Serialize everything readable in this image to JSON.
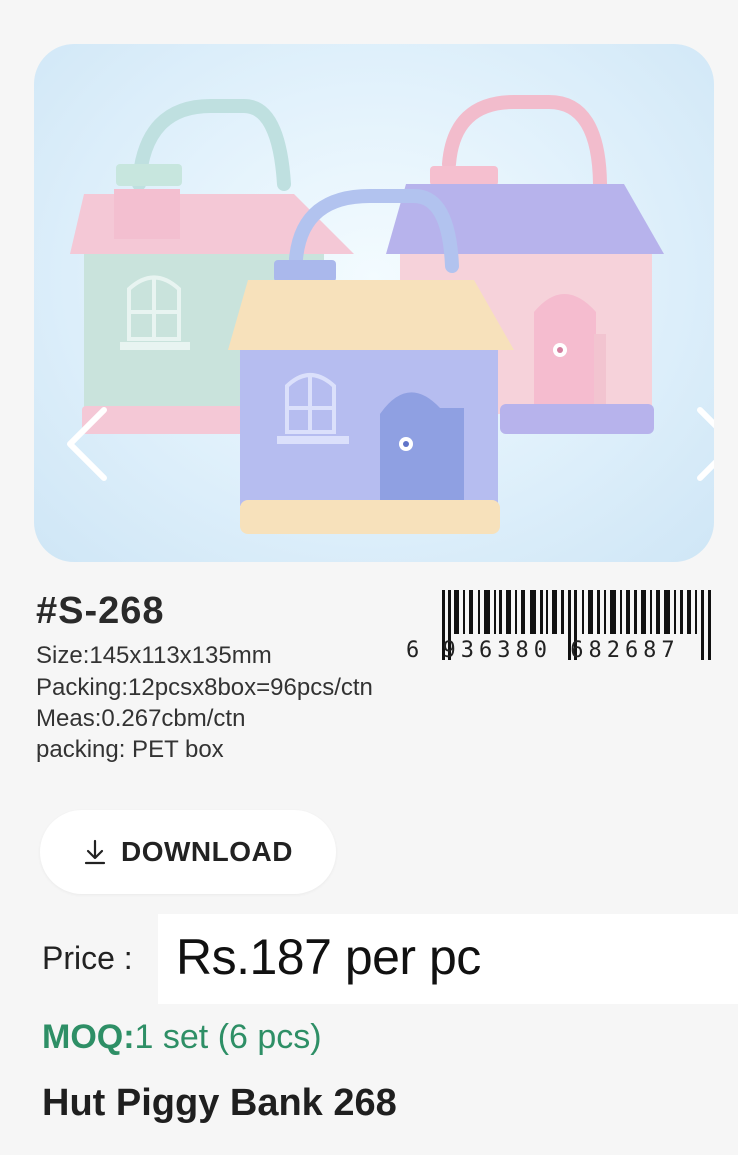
{
  "product_image": {
    "alt": "Three pastel house-shaped piggy banks",
    "prev_icon": "chevron-left-icon",
    "next_icon": "chevron-right-icon"
  },
  "specs": {
    "model_no": "#S-268",
    "size": "Size:145x113x135mm",
    "packing": "Packing:12pcsx8box=96pcs/ctn",
    "meas": "Meas:0.267cbm/ctn",
    "box": "packing: PET box",
    "barcode_digits": "6 936380 682687"
  },
  "download": {
    "label": "DOWNLOAD",
    "icon": "download-icon"
  },
  "price": {
    "label": "Price :",
    "value": "Rs.187 per pc"
  },
  "moq": {
    "label": "MOQ:",
    "value": "1 set (6 pcs)"
  },
  "title": "Hut Piggy Bank 268",
  "colors": {
    "moq_green": "#2e8f66",
    "card_bg": "#dff0fb"
  }
}
